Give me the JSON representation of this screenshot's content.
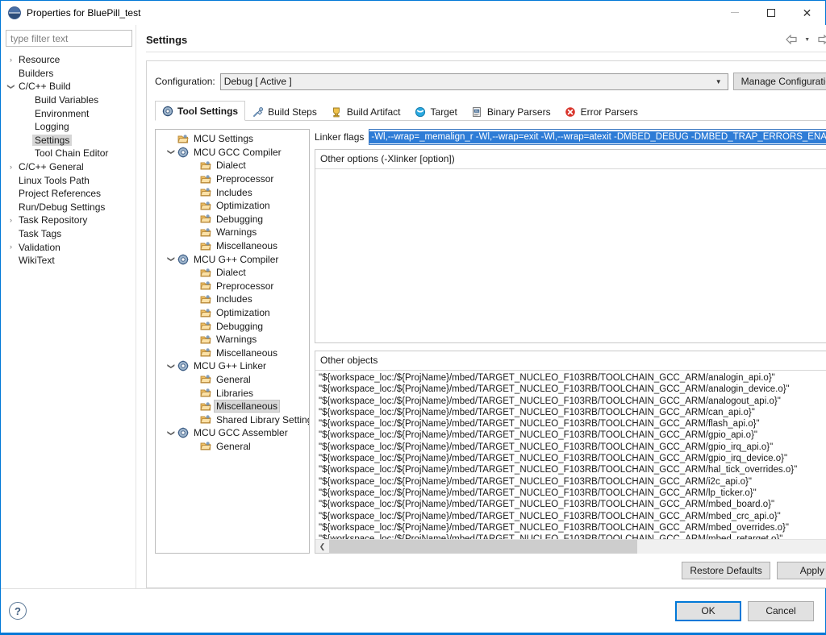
{
  "window": {
    "title": "Properties for BluePill_test",
    "app_icon": "eclipse-icon",
    "minimize": "minimize-icon",
    "maximize": "maximize-icon",
    "close": "close-icon",
    "accent_color": "#0078d7"
  },
  "filter": {
    "placeholder": "type filter text",
    "value": ""
  },
  "sidebar": {
    "items": [
      {
        "label": "Resource",
        "twisty": "›",
        "indent": 0,
        "selected": false
      },
      {
        "label": "Builders",
        "twisty": "",
        "indent": 0,
        "selected": false
      },
      {
        "label": "C/C++ Build",
        "twisty": "⌄",
        "indent": 0,
        "selected": false
      },
      {
        "label": "Build Variables",
        "twisty": "",
        "indent": 1,
        "selected": false
      },
      {
        "label": "Environment",
        "twisty": "",
        "indent": 1,
        "selected": false
      },
      {
        "label": "Logging",
        "twisty": "",
        "indent": 1,
        "selected": false
      },
      {
        "label": "Settings",
        "twisty": "",
        "indent": 1,
        "selected": true
      },
      {
        "label": "Tool Chain Editor",
        "twisty": "",
        "indent": 1,
        "selected": false
      },
      {
        "label": "C/C++ General",
        "twisty": "›",
        "indent": 0,
        "selected": false
      },
      {
        "label": "Linux Tools Path",
        "twisty": "",
        "indent": 0,
        "selected": false
      },
      {
        "label": "Project References",
        "twisty": "",
        "indent": 0,
        "selected": false
      },
      {
        "label": "Run/Debug Settings",
        "twisty": "",
        "indent": 0,
        "selected": false
      },
      {
        "label": "Task Repository",
        "twisty": "›",
        "indent": 0,
        "selected": false
      },
      {
        "label": "Task Tags",
        "twisty": "",
        "indent": 0,
        "selected": false
      },
      {
        "label": "Validation",
        "twisty": "›",
        "indent": 0,
        "selected": false
      },
      {
        "label": "WikiText",
        "twisty": "",
        "indent": 0,
        "selected": false
      }
    ]
  },
  "header": {
    "title": "Settings",
    "nav": [
      {
        "icon": "back-arrow-icon"
      },
      {
        "icon": "back-dropdown-icon"
      },
      {
        "icon": "forward-arrow-icon"
      },
      {
        "icon": "forward-dropdown-icon"
      },
      {
        "icon": "view-menu-icon"
      }
    ]
  },
  "configuration": {
    "label": "Configuration:",
    "value": "Debug  [ Active ]",
    "dropdown_icon": "chevron-down-icon",
    "manage_button": "Manage Configurations..."
  },
  "tabs": [
    {
      "label": "Tool Settings",
      "icon": "tool-settings-icon",
      "active": true
    },
    {
      "label": "Build Steps",
      "icon": "build-steps-icon",
      "active": false
    },
    {
      "label": "Build Artifact",
      "icon": "build-artifact-icon",
      "active": false
    },
    {
      "label": "Target",
      "icon": "target-icon",
      "active": false
    },
    {
      "label": "Binary Parsers",
      "icon": "binary-parsers-icon",
      "active": false
    },
    {
      "label": "Error Parsers",
      "icon": "error-parsers-icon",
      "active": false
    }
  ],
  "tool_tree": {
    "items": [
      {
        "label": "MCU Settings",
        "twisty": "",
        "level": 1,
        "icon": "folder-icon",
        "selected": false
      },
      {
        "label": "MCU GCC Compiler",
        "twisty": "⌄",
        "level": 0,
        "icon": "tool-icon",
        "selected": false
      },
      {
        "label": "Dialect",
        "twisty": "",
        "level": 2,
        "icon": "folder-icon",
        "selected": false
      },
      {
        "label": "Preprocessor",
        "twisty": "",
        "level": 2,
        "icon": "folder-icon",
        "selected": false
      },
      {
        "label": "Includes",
        "twisty": "",
        "level": 2,
        "icon": "folder-icon",
        "selected": false
      },
      {
        "label": "Optimization",
        "twisty": "",
        "level": 2,
        "icon": "folder-icon",
        "selected": false
      },
      {
        "label": "Debugging",
        "twisty": "",
        "level": 2,
        "icon": "folder-icon",
        "selected": false
      },
      {
        "label": "Warnings",
        "twisty": "",
        "level": 2,
        "icon": "folder-icon",
        "selected": false
      },
      {
        "label": "Miscellaneous",
        "twisty": "",
        "level": 2,
        "icon": "folder-icon",
        "selected": false
      },
      {
        "label": "MCU G++ Compiler",
        "twisty": "⌄",
        "level": 0,
        "icon": "tool-icon",
        "selected": false
      },
      {
        "label": "Dialect",
        "twisty": "",
        "level": 2,
        "icon": "folder-icon",
        "selected": false
      },
      {
        "label": "Preprocessor",
        "twisty": "",
        "level": 2,
        "icon": "folder-icon",
        "selected": false
      },
      {
        "label": "Includes",
        "twisty": "",
        "level": 2,
        "icon": "folder-icon",
        "selected": false
      },
      {
        "label": "Optimization",
        "twisty": "",
        "level": 2,
        "icon": "folder-icon",
        "selected": false
      },
      {
        "label": "Debugging",
        "twisty": "",
        "level": 2,
        "icon": "folder-icon",
        "selected": false
      },
      {
        "label": "Warnings",
        "twisty": "",
        "level": 2,
        "icon": "folder-icon",
        "selected": false
      },
      {
        "label": "Miscellaneous",
        "twisty": "",
        "level": 2,
        "icon": "folder-icon",
        "selected": false
      },
      {
        "label": "MCU G++ Linker",
        "twisty": "⌄",
        "level": 0,
        "icon": "tool-icon",
        "selected": false
      },
      {
        "label": "General",
        "twisty": "",
        "level": 2,
        "icon": "folder-icon",
        "selected": false
      },
      {
        "label": "Libraries",
        "twisty": "",
        "level": 2,
        "icon": "folder-icon",
        "selected": false
      },
      {
        "label": "Miscellaneous",
        "twisty": "",
        "level": 2,
        "icon": "folder-icon",
        "selected": true
      },
      {
        "label": "Shared Library Settings",
        "twisty": "",
        "level": 2,
        "icon": "folder-icon",
        "selected": false
      },
      {
        "label": "MCU GCC Assembler",
        "twisty": "⌄",
        "level": 0,
        "icon": "tool-icon",
        "selected": false
      },
      {
        "label": "General",
        "twisty": "",
        "level": 2,
        "icon": "folder-icon",
        "selected": false
      }
    ]
  },
  "linker_flags": {
    "label": "Linker flags",
    "value": "-Wl,--wrap=_memalign_r -Wl,--wrap=exit -Wl,--wrap=atexit -DMBED_DEBUG -DMBED_TRAP_ERRORS_ENABLED=",
    "selected": true,
    "selection_bg": "#2e7cd6",
    "selection_fg": "#ffffff"
  },
  "other_options": {
    "label": "Other options (-Xlinker [option])",
    "items": []
  },
  "other_objects": {
    "label": "Other objects",
    "items": [
      "\"${workspace_loc:/${ProjName}/mbed/TARGET_NUCLEO_F103RB/TOOLCHAIN_GCC_ARM/analogin_api.o}\"",
      "\"${workspace_loc:/${ProjName}/mbed/TARGET_NUCLEO_F103RB/TOOLCHAIN_GCC_ARM/analogin_device.o}\"",
      "\"${workspace_loc:/${ProjName}/mbed/TARGET_NUCLEO_F103RB/TOOLCHAIN_GCC_ARM/analogout_api.o}\"",
      "\"${workspace_loc:/${ProjName}/mbed/TARGET_NUCLEO_F103RB/TOOLCHAIN_GCC_ARM/can_api.o}\"",
      "\"${workspace_loc:/${ProjName}/mbed/TARGET_NUCLEO_F103RB/TOOLCHAIN_GCC_ARM/flash_api.o}\"",
      "\"${workspace_loc:/${ProjName}/mbed/TARGET_NUCLEO_F103RB/TOOLCHAIN_GCC_ARM/gpio_api.o}\"",
      "\"${workspace_loc:/${ProjName}/mbed/TARGET_NUCLEO_F103RB/TOOLCHAIN_GCC_ARM/gpio_irq_api.o}\"",
      "\"${workspace_loc:/${ProjName}/mbed/TARGET_NUCLEO_F103RB/TOOLCHAIN_GCC_ARM/gpio_irq_device.o}\"",
      "\"${workspace_loc:/${ProjName}/mbed/TARGET_NUCLEO_F103RB/TOOLCHAIN_GCC_ARM/hal_tick_overrides.o}\"",
      "\"${workspace_loc:/${ProjName}/mbed/TARGET_NUCLEO_F103RB/TOOLCHAIN_GCC_ARM/i2c_api.o}\"",
      "\"${workspace_loc:/${ProjName}/mbed/TARGET_NUCLEO_F103RB/TOOLCHAIN_GCC_ARM/lp_ticker.o}\"",
      "\"${workspace_loc:/${ProjName}/mbed/TARGET_NUCLEO_F103RB/TOOLCHAIN_GCC_ARM/mbed_board.o}\"",
      "\"${workspace_loc:/${ProjName}/mbed/TARGET_NUCLEO_F103RB/TOOLCHAIN_GCC_ARM/mbed_crc_api.o}\"",
      "\"${workspace_loc:/${ProjName}/mbed/TARGET_NUCLEO_F103RB/TOOLCHAIN_GCC_ARM/mbed_overrides.o}\"",
      "\"${workspace_loc:/${ProjName}/mbed/TARGET_NUCLEO_F103RB/TOOLCHAIN_GCC_ARM/mbed_retarget.o}\""
    ],
    "scroll_left_icon": "chevron-left-icon",
    "scroll_right_icon": "chevron-right-icon"
  },
  "footer": {
    "restore_defaults": "Restore Defaults",
    "apply": "Apply",
    "ok": "OK",
    "cancel": "Cancel",
    "help_icon": "help-icon"
  }
}
